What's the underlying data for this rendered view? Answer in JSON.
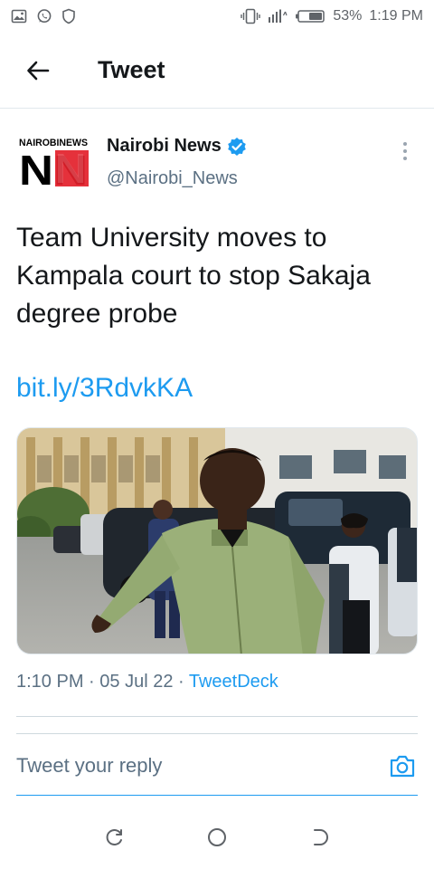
{
  "status_bar": {
    "battery": "53%",
    "time": "1:19 PM",
    "icons": [
      "image-icon",
      "whatsapp-icon",
      "shield-icon",
      "vibrate-icon",
      "signal-icon",
      "battery-icon"
    ]
  },
  "app_bar": {
    "title": "Tweet",
    "back_icon": "arrow-left-icon"
  },
  "tweet": {
    "author_name": "Nairobi News",
    "author_handle": "@Nairobi_News",
    "avatar_top_text": "NAIROBINEWS",
    "avatar_letters": "NN",
    "verified": true,
    "text": "Team University moves to Kampala court to stop Sakaja degree probe",
    "link": "bit.ly/3RdvkKA",
    "time": "1:10 PM",
    "separator": "·",
    "date": "05 Jul 22",
    "source": "TweetDeck"
  },
  "reply": {
    "placeholder": "Tweet your reply",
    "camera_icon": "camera-icon"
  },
  "nav": {
    "items": [
      "recents-icon",
      "home-icon",
      "back-icon"
    ]
  },
  "colors": {
    "accent": "#1d9bf0",
    "text": "#14171a",
    "muted": "#5b7083",
    "avatar_red": "#e3202a"
  }
}
